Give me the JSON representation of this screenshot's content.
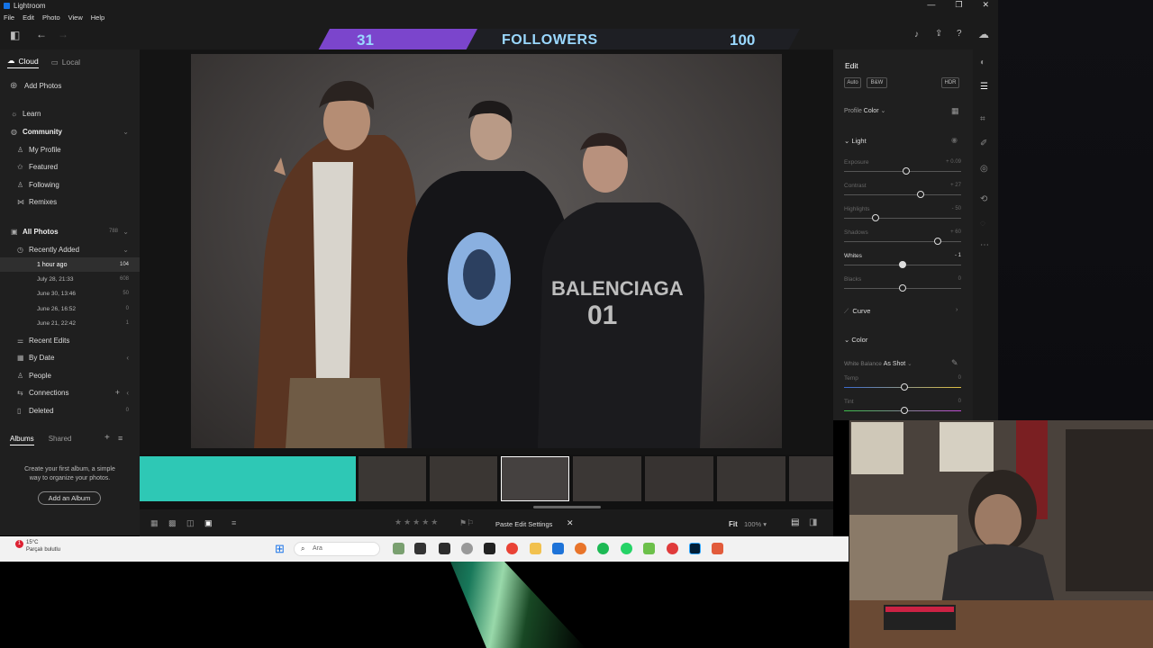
{
  "window": {
    "title": "Lightroom",
    "controls": [
      "—",
      "❐",
      "✕"
    ]
  },
  "menu": [
    "File",
    "Edit",
    "Photo",
    "View",
    "Help"
  ],
  "overlay": {
    "current": "31",
    "label": "FOLLOWERS",
    "goal": "100",
    "progress": 0.31,
    "color": "#7b45cc"
  },
  "left": {
    "tabs": [
      "Cloud",
      "Local"
    ],
    "add_photos": "Add Photos",
    "learn": "Learn",
    "community": "Community",
    "community_items": [
      "My Profile",
      "Featured",
      "Following",
      "Remixes"
    ],
    "all_photos": "All Photos",
    "all_photos_count": "788",
    "recently_added": "Recently Added",
    "dates": [
      {
        "label": "1 hour ago",
        "count": "104"
      },
      {
        "label": "July 28, 21:33",
        "count": "608"
      },
      {
        "label": "June 30, 13:46",
        "count": "50"
      },
      {
        "label": "June 26, 16:52",
        "count": "0"
      },
      {
        "label": "June 21, 22:42",
        "count": "1"
      }
    ],
    "recent_edits": "Recent Edits",
    "by_date": "By Date",
    "people": "People",
    "connections": "Connections",
    "deleted": "Deleted",
    "deleted_count": "0",
    "albums_tabs": [
      "Albums",
      "Shared"
    ],
    "albums_hint": "Create your first album, a simple way to organize your photos.",
    "add_album": "Add an Album"
  },
  "edit": {
    "title": "Edit",
    "buttons": [
      "Auto",
      "B&W",
      "HDR"
    ],
    "profile_label": "Profile",
    "profile_value": "Color",
    "light": "Light",
    "sliders": [
      {
        "label": "Exposure",
        "value": "+ 0.09",
        "pos": 0.53
      },
      {
        "label": "Contrast",
        "value": "+ 27",
        "pos": 0.65
      },
      {
        "label": "Highlights",
        "value": "- 50",
        "pos": 0.27
      },
      {
        "label": "Shadows",
        "value": "+ 60",
        "pos": 0.8
      },
      {
        "label": "Whites",
        "value": "- 1",
        "pos": 0.5
      },
      {
        "label": "Blacks",
        "value": "0",
        "pos": 0.5
      }
    ],
    "curve": "Curve",
    "color": "Color",
    "wb_label": "White Balance",
    "wb_value": "As Shot",
    "temp": "Temp",
    "temp_value": "0",
    "tint": "Tint",
    "tint_value": "0"
  },
  "bottom": {
    "paste": "Paste Edit Settings",
    "fit": "Fit",
    "zoom": "100% ▾"
  },
  "taskbar": {
    "temp": "15°C",
    "weather": "Parçalı bulutlu",
    "search": "Ara",
    "notif": "1"
  }
}
